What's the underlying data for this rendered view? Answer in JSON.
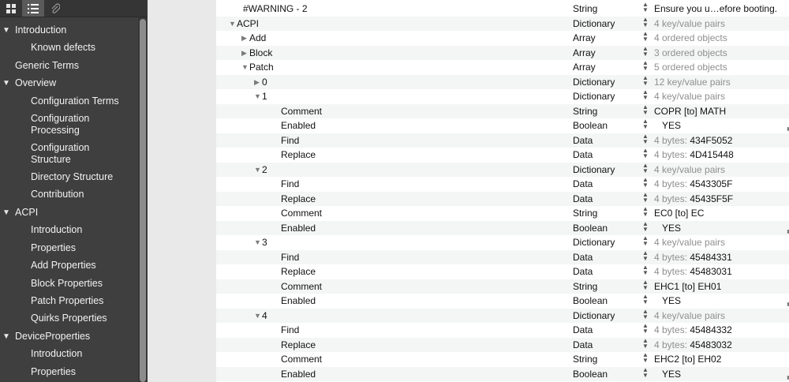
{
  "sidebar": {
    "items": [
      {
        "label": "Introduction",
        "expanded": true,
        "level": 0
      },
      {
        "label": "Known defects",
        "level": 1
      },
      {
        "label": "Generic Terms",
        "level": 0
      },
      {
        "label": "Overview",
        "expanded": true,
        "level": 0
      },
      {
        "label": "Configuration Terms",
        "level": 1
      },
      {
        "label": "Configuration Processing",
        "level": 1
      },
      {
        "label": "Configuration Structure",
        "level": 1
      },
      {
        "label": "Directory Structure",
        "level": 1
      },
      {
        "label": "Contribution",
        "level": 1
      },
      {
        "label": "ACPI",
        "expanded": true,
        "level": 0
      },
      {
        "label": "Introduction",
        "level": 1
      },
      {
        "label": "Properties",
        "level": 1
      },
      {
        "label": "Add Properties",
        "level": 1
      },
      {
        "label": "Block Properties",
        "level": 1
      },
      {
        "label": "Patch Properties",
        "level": 1
      },
      {
        "label": "Quirks Properties",
        "level": 1
      },
      {
        "label": "DeviceProperties",
        "expanded": true,
        "level": 0
      },
      {
        "label": "Introduction",
        "level": 1
      },
      {
        "label": "Properties",
        "level": 1
      }
    ],
    "multi": {
      "config_processing": [
        "Configuration",
        "Processing"
      ],
      "config_structure": [
        "Configuration",
        "Structure"
      ]
    }
  },
  "rows": [
    {
      "key": "#WARNING - 2",
      "type": "String",
      "value": "Ensure you u…efore booting."
    },
    {
      "key": "ACPI",
      "type": "Dictionary",
      "value": "4 key/value pairs",
      "disc": "open"
    },
    {
      "key": "Add",
      "type": "Array",
      "value": "4 ordered objects",
      "disc": "closed"
    },
    {
      "key": "Block",
      "type": "Array",
      "value": "3 ordered objects",
      "disc": "closed"
    },
    {
      "key": "Patch",
      "type": "Array",
      "value": "5 ordered objects",
      "disc": "open"
    },
    {
      "key": "0",
      "type": "Dictionary",
      "value": "12 key/value pairs",
      "disc": "closed"
    },
    {
      "key": "1",
      "type": "Dictionary",
      "value": "4 key/value pairs",
      "disc": "open"
    },
    {
      "key": "Comment",
      "type": "String",
      "value": "COPR [to] MATH"
    },
    {
      "key": "Enabled",
      "type": "Boolean",
      "value": "YES"
    },
    {
      "key": "Find",
      "type": "Data",
      "bytes": "4 bytes:",
      "hex": "434F5052"
    },
    {
      "key": "Replace",
      "type": "Data",
      "bytes": "4 bytes:",
      "hex": "4D415448"
    },
    {
      "key": "2",
      "type": "Dictionary",
      "value": "4 key/value pairs",
      "disc": "open"
    },
    {
      "key": "Find",
      "type": "Data",
      "bytes": "4 bytes:",
      "hex": "4543305F"
    },
    {
      "key": "Replace",
      "type": "Data",
      "bytes": "4 bytes:",
      "hex": "45435F5F"
    },
    {
      "key": "Comment",
      "type": "String",
      "value": "EC0 [to] EC"
    },
    {
      "key": "Enabled",
      "type": "Boolean",
      "value": "YES"
    },
    {
      "key": "3",
      "type": "Dictionary",
      "value": "4 key/value pairs",
      "disc": "open"
    },
    {
      "key": "Find",
      "type": "Data",
      "bytes": "4 bytes:",
      "hex": "45484331"
    },
    {
      "key": "Replace",
      "type": "Data",
      "bytes": "4 bytes:",
      "hex": "45483031"
    },
    {
      "key": "Comment",
      "type": "String",
      "value": "EHC1 [to] EH01"
    },
    {
      "key": "Enabled",
      "type": "Boolean",
      "value": "YES"
    },
    {
      "key": "4",
      "type": "Dictionary",
      "value": "4 key/value pairs",
      "disc": "open"
    },
    {
      "key": "Find",
      "type": "Data",
      "bytes": "4 bytes:",
      "hex": "45484332"
    },
    {
      "key": "Replace",
      "type": "Data",
      "bytes": "4 bytes:",
      "hex": "45483032"
    },
    {
      "key": "Comment",
      "type": "String",
      "value": "EHC2 [to] EH02"
    },
    {
      "key": "Enabled",
      "type": "Boolean",
      "value": "YES"
    }
  ],
  "colors": {
    "sidebar_bg": "#3f3f3f",
    "gutter_bg": "#e9e9e9",
    "row_alt": "#f4f5f5"
  }
}
